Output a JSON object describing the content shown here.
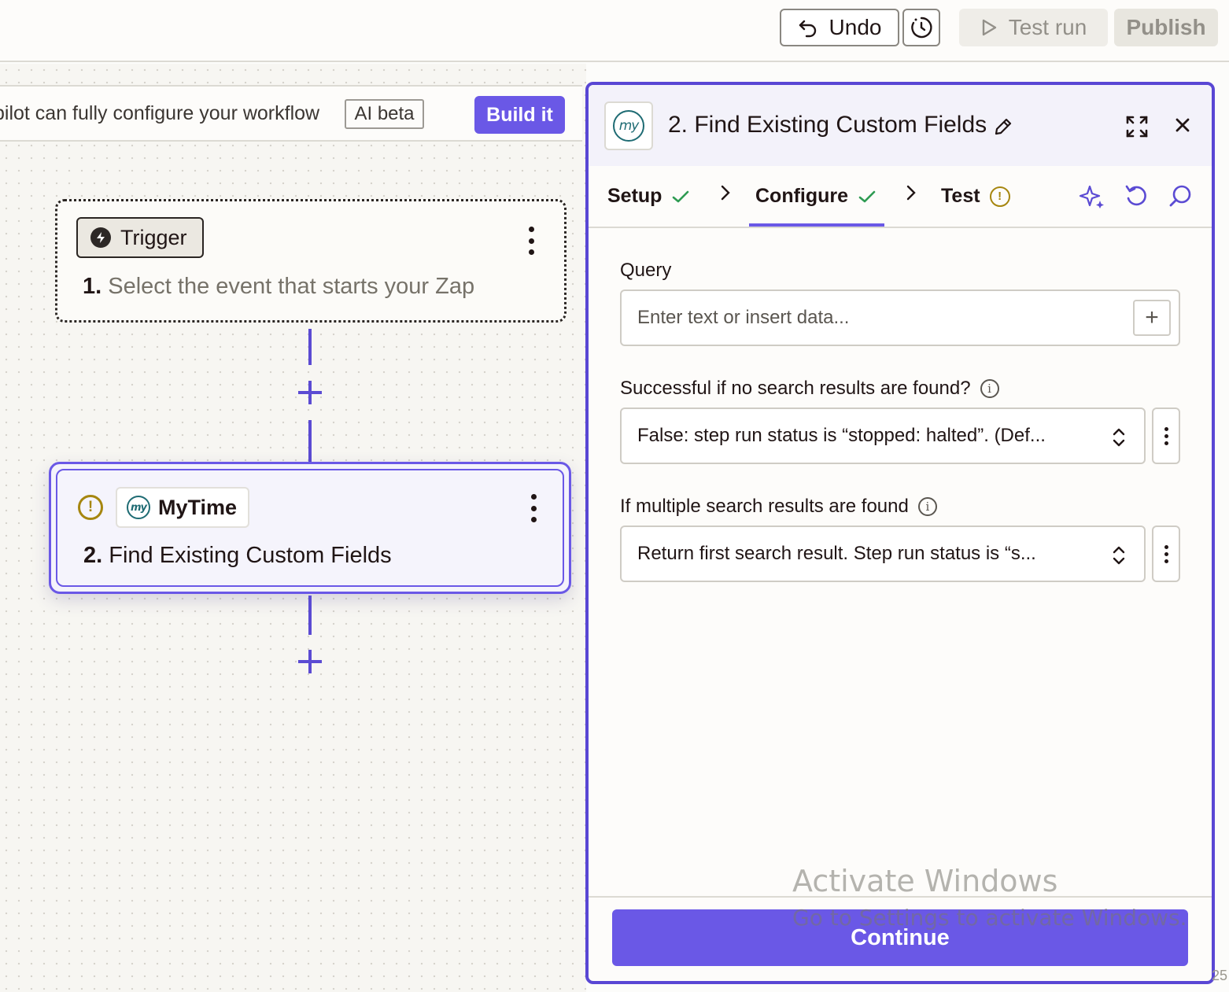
{
  "toolbar": {
    "undo_label": "Undo",
    "history_icon": "history-clock-icon",
    "test_run_label": "Test run",
    "publish_label": "Publish"
  },
  "copilot": {
    "text": "pilot can fully configure your workflow",
    "badge": "AI beta",
    "build_label": "Build it"
  },
  "canvas": {
    "trigger": {
      "pill_label": "Trigger",
      "number": "1.",
      "title": "Select the event that starts your Zap"
    },
    "step": {
      "app_name": "MyTime",
      "number": "2.",
      "title": "Find Existing Custom Fields",
      "status": "warning"
    }
  },
  "panel": {
    "app_logo_text": "my",
    "title": "2. Find Existing Custom Fields",
    "tabs": [
      {
        "label": "Setup",
        "status": "complete"
      },
      {
        "label": "Configure",
        "status": "complete",
        "active": true
      },
      {
        "label": "Test",
        "status": "warning"
      }
    ],
    "fields": {
      "query": {
        "label": "Query",
        "placeholder": "Enter text or insert data..."
      },
      "no_results": {
        "label": "Successful if no search results are found?",
        "value": "False: step run status is “stopped: halted”. (Def..."
      },
      "multiple_results": {
        "label": "If multiple search results are found",
        "value": "Return first search result. Step run status is “s..."
      }
    },
    "continue_label": "Continue"
  },
  "overlay": {
    "watermark_title": "Activate Windows",
    "watermark_sub": "Go to Settings to activate Windows.",
    "corner_text": "25"
  },
  "colors": {
    "accent": "#6a58e6",
    "warning": "#a6860f",
    "success": "#2e9b52",
    "brand_logo": "#1e6b73"
  }
}
